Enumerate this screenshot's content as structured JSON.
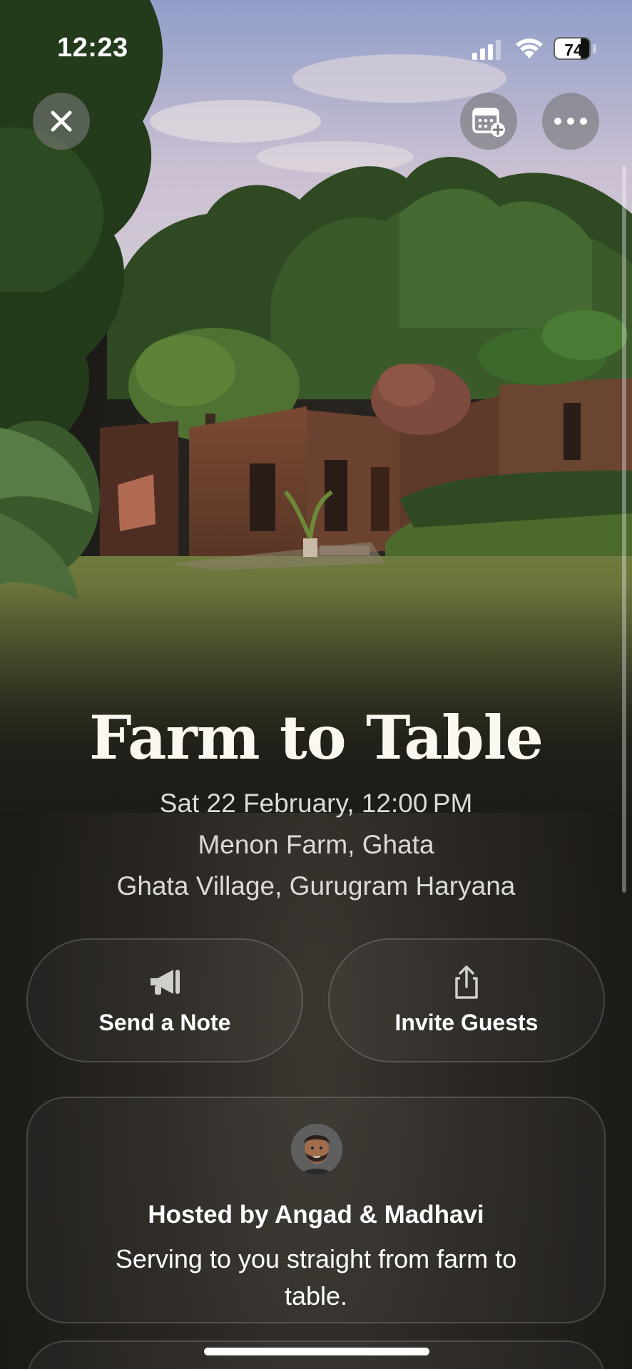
{
  "status_bar": {
    "time": "12:23",
    "battery": "74",
    "battery_level": 0.74
  },
  "header": {
    "close_icon": "close-icon",
    "calendar_icon": "calendar-add-icon",
    "more_icon": "more-icon"
  },
  "event": {
    "title": "Farm to Table",
    "date_time": "Sat 22 February, 12:00 PM",
    "venue": "Menon Farm, Ghata",
    "address": "Ghata Village, Gurugram Haryana"
  },
  "actions": {
    "send_note": {
      "label": "Send a Note",
      "icon": "megaphone-icon"
    },
    "invite_guests": {
      "label": "Invite Guests",
      "icon": "share-icon"
    }
  },
  "host": {
    "title": "Hosted by Angad & Madhavi",
    "description": "Serving to you straight from farm to table.",
    "avatar_icon": "memoji-avatar"
  },
  "colors": {
    "background": "#1e1c18",
    "button_overlay": "#7a7a7a",
    "text_primary": "#ffffff",
    "text_secondary": "#dcdad6"
  }
}
